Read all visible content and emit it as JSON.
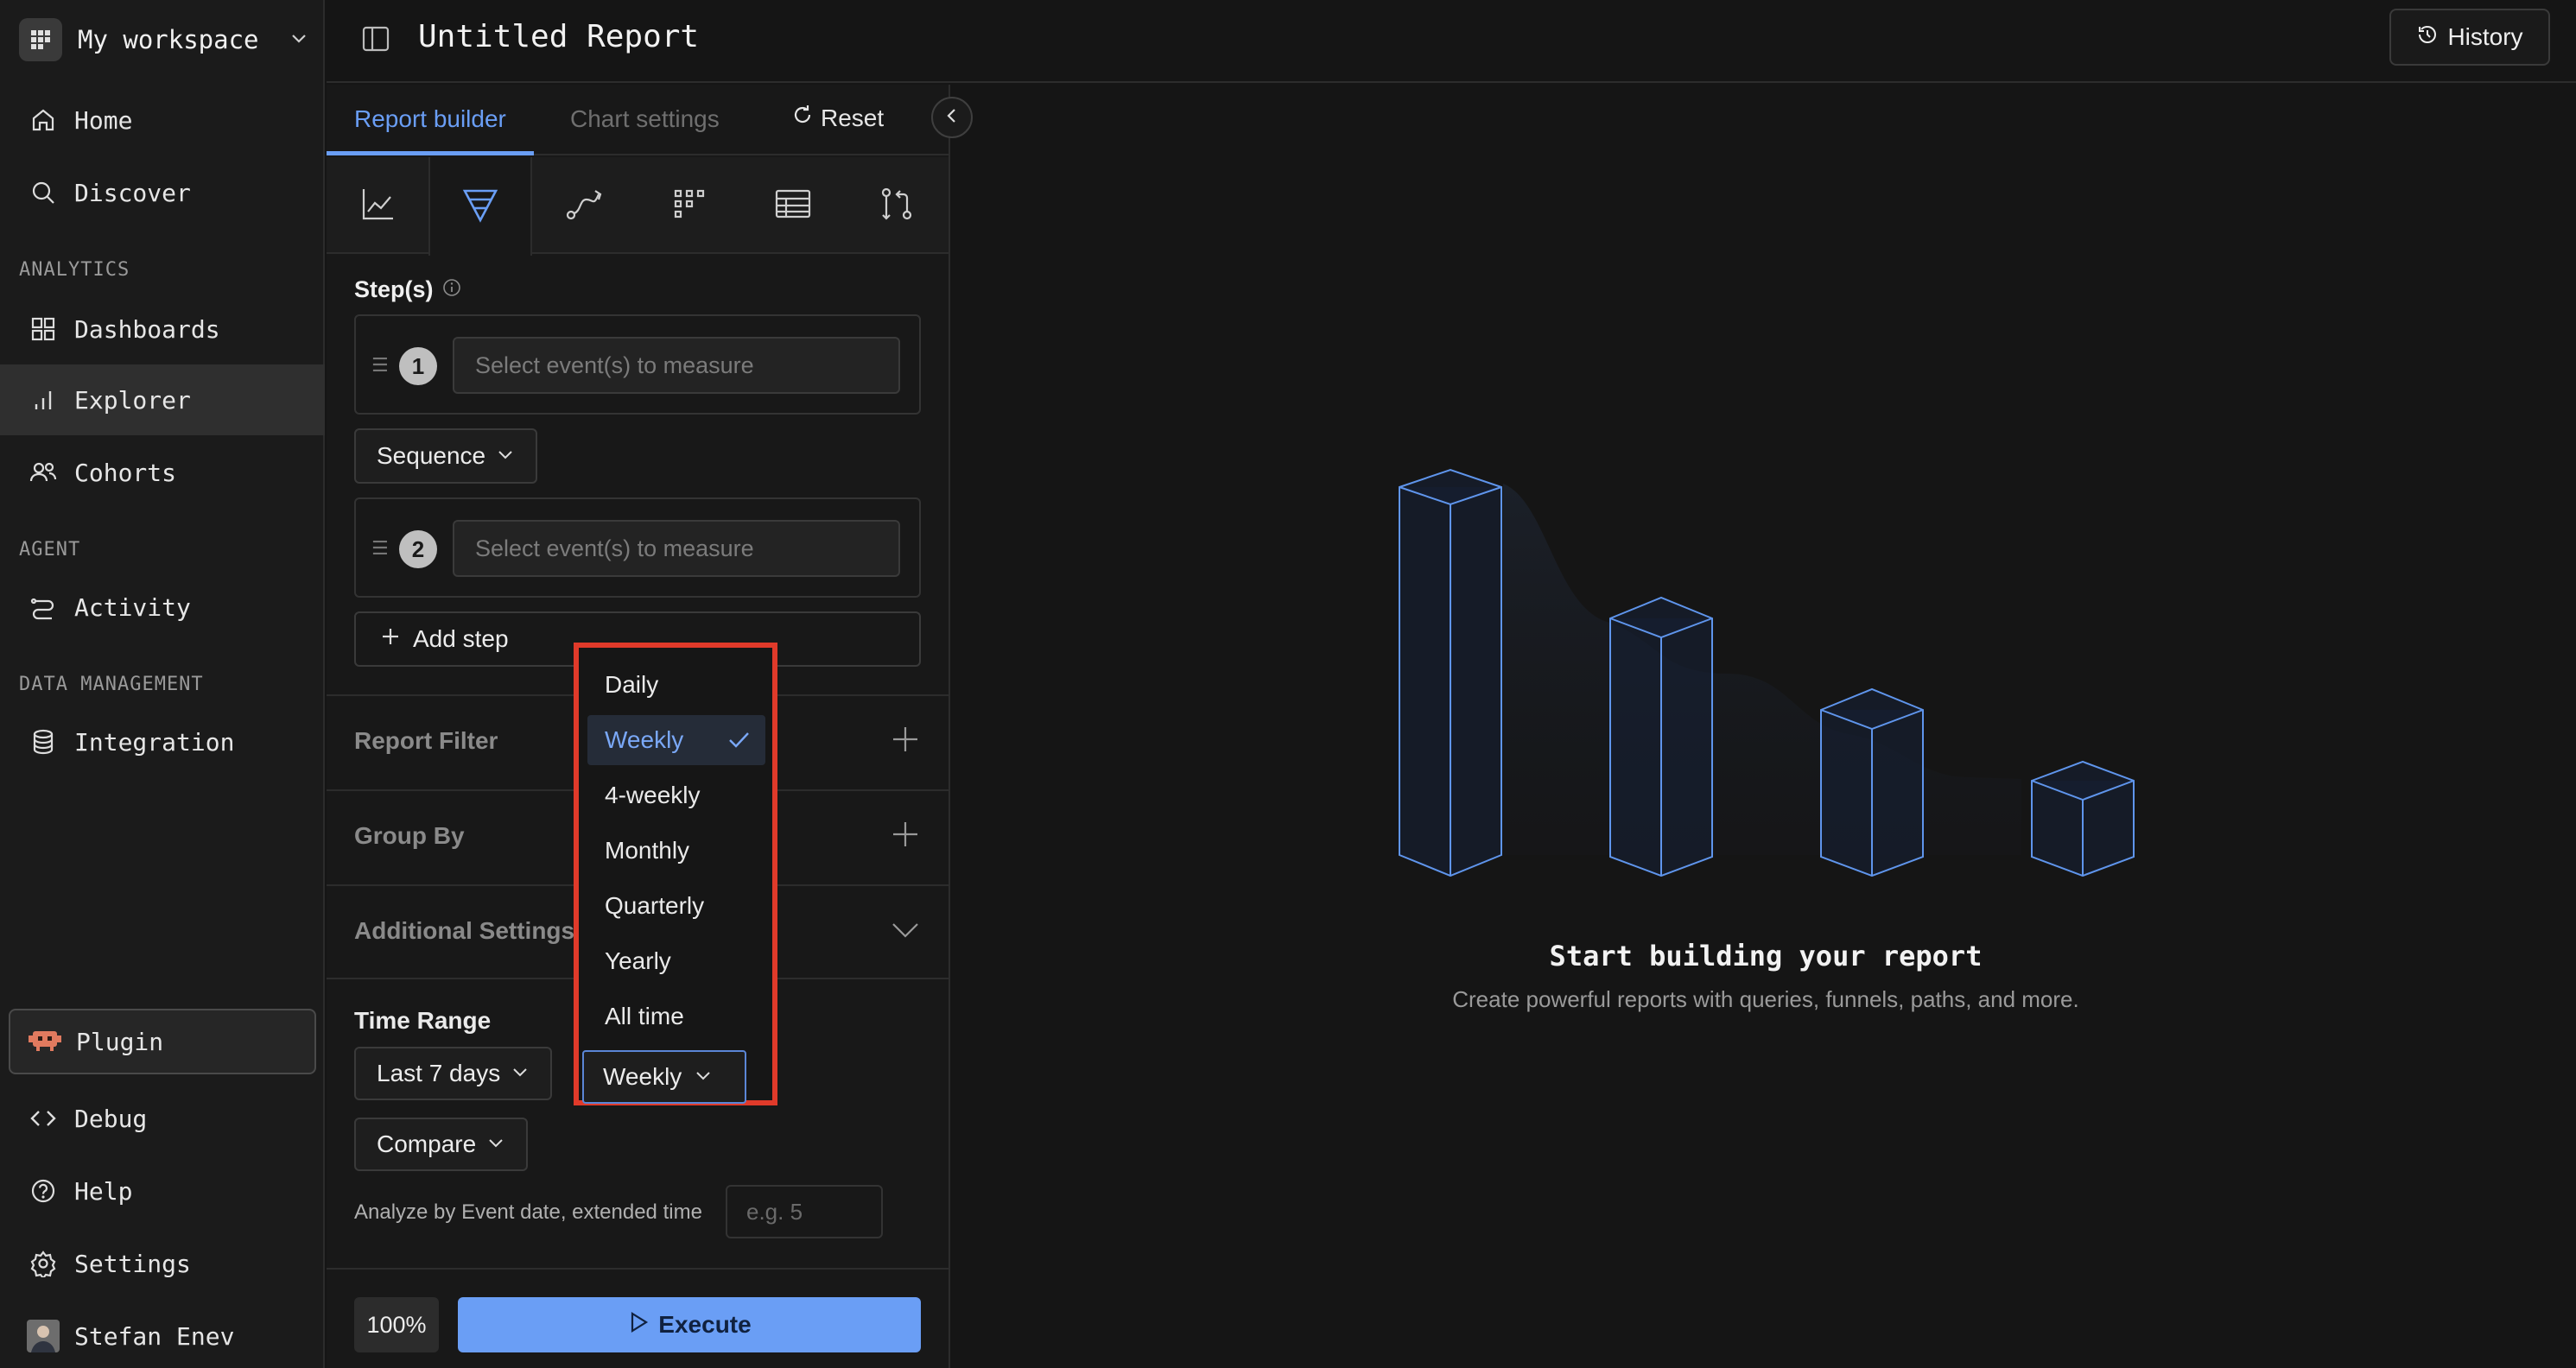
{
  "workspace": {
    "name": "My workspace"
  },
  "nav": {
    "home": "Home",
    "discover": "Discover",
    "analytics_title": "ANALYTICS",
    "dashboards": "Dashboards",
    "explorer": "Explorer",
    "cohorts": "Cohorts",
    "agent_title": "AGENT",
    "activity": "Activity",
    "data_title": "DATA MANAGEMENT",
    "integration": "Integration",
    "plugin": "Plugin",
    "debug": "Debug",
    "help": "Help",
    "settings": "Settings",
    "user": "Stefan Enev"
  },
  "header": {
    "title": "Untitled Report",
    "history": "History"
  },
  "builder": {
    "tabs": {
      "report_builder": "Report builder",
      "chart_settings": "Chart settings",
      "reset": "Reset"
    },
    "steps_label": "Step(s)",
    "steps": [
      {
        "num": "1",
        "placeholder": "Select event(s) to measure"
      },
      {
        "num": "2",
        "placeholder": "Select event(s) to measure"
      }
    ],
    "sequence": "Sequence",
    "add_step": "Add step",
    "report_filter": "Report Filter",
    "group_by": "Group By",
    "additional_settings": "Additional Settings",
    "time_range_label": "Time Range",
    "time_range_value": "Last 7 days",
    "interval_value": "Weekly",
    "compare": "Compare",
    "analyze_text": "Analyze by Event  date, extended time",
    "extended_placeholder": "e.g. 5",
    "zoom": "100%",
    "execute": "Execute"
  },
  "interval_dropdown": {
    "options": [
      "Daily",
      "Weekly",
      "4-weekly",
      "Monthly",
      "Quarterly",
      "Yearly",
      "All time"
    ],
    "selected": "Weekly"
  },
  "empty_state": {
    "title": "Start building your report",
    "subtitle": "Create powerful reports with queries, funnels, paths, and more."
  },
  "colors": {
    "accent": "#6a9ef5",
    "highlight_border": "#e03a2a"
  }
}
